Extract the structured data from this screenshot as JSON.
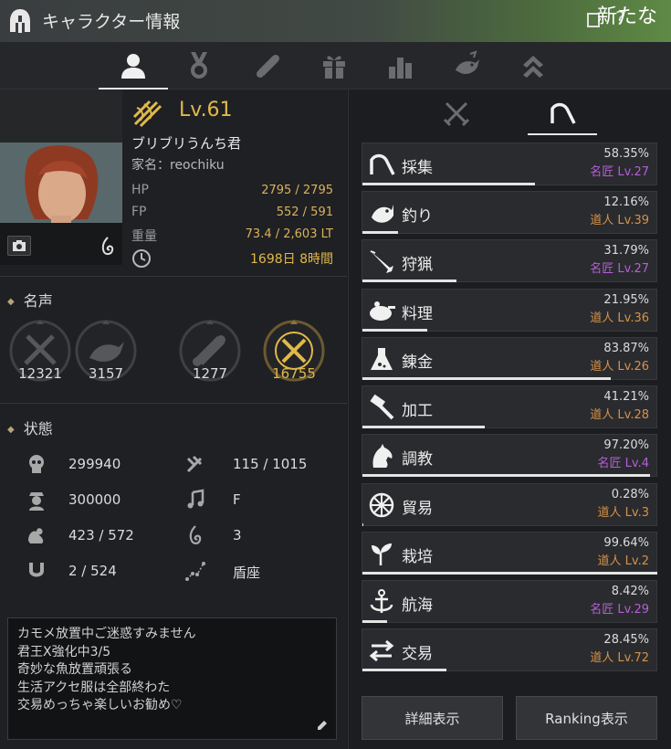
{
  "window": {
    "title": "キャラクター情報",
    "overflow_text": "新たな"
  },
  "tabs": [
    "profile-icon",
    "medal-icon",
    "scroll-icon",
    "gift-icon",
    "bar-chart-icon",
    "fishing-icon",
    "chevron-up-icon"
  ],
  "character": {
    "level": "Lv.61",
    "name": "ブリブリうんち君",
    "family": "家名：reochiku",
    "hp_label": "HP",
    "hp": "2795 / 2795",
    "fp_label": "FP",
    "fp": "552 / 591",
    "weight_label": "重量",
    "weight": "73.4 / 2,603 LT",
    "playtime": "1698日 8時間"
  },
  "fame": {
    "title": "名声",
    "items": [
      {
        "icon": "crossed-swords-icon",
        "value": "12321"
      },
      {
        "icon": "fishing-icon",
        "value": "3157"
      },
      {
        "icon": "scroll-icon",
        "value": "1277"
      },
      {
        "icon": "crossed-tools-icon",
        "value": "16755"
      }
    ]
  },
  "status": {
    "title": "状態",
    "stats": [
      {
        "icon": "skull-icon",
        "value": "299940"
      },
      {
        "icon": "axe-icon",
        "value": "115 / 1015"
      },
      {
        "icon": "soldier-icon",
        "value": "300000"
      },
      {
        "icon": "music-note-icon",
        "value": "F"
      },
      {
        "icon": "muscle-icon",
        "value": "423 / 572"
      },
      {
        "icon": "flame-icon",
        "value": "3"
      },
      {
        "icon": "horseshoe-icon",
        "value": "2 / 524"
      },
      {
        "icon": "constellation-icon",
        "value": "盾座"
      }
    ]
  },
  "memo": {
    "lines": [
      "カモメ放置中ご迷惑すみません",
      "君王X強化中3/5",
      "奇妙な魚放置頑張る",
      "生活アクセ服は全部終わた",
      "交易めっちゃ楽しいお勧め♡"
    ]
  },
  "life_skills": [
    {
      "name": "採集",
      "percent": "58.35%",
      "rank": "名匠 Lv.27",
      "tier": "guru",
      "progress": 58.35
    },
    {
      "name": "釣り",
      "percent": "12.16%",
      "rank": "道人 Lv.39",
      "tier": "master",
      "progress": 12.16
    },
    {
      "name": "狩猟",
      "percent": "31.79%",
      "rank": "名匠 Lv.27",
      "tier": "guru",
      "progress": 31.79
    },
    {
      "name": "料理",
      "percent": "21.95%",
      "rank": "道人 Lv.36",
      "tier": "master",
      "progress": 21.95
    },
    {
      "name": "錬金",
      "percent": "83.87%",
      "rank": "道人 Lv.26",
      "tier": "master",
      "progress": 83.87
    },
    {
      "name": "加工",
      "percent": "41.21%",
      "rank": "道人 Lv.28",
      "tier": "master",
      "progress": 41.21
    },
    {
      "name": "調教",
      "percent": "97.20%",
      "rank": "名匠 Lv.4",
      "tier": "guru",
      "progress": 97.2
    },
    {
      "name": "貿易",
      "percent": "0.28%",
      "rank": "道人 Lv.3",
      "tier": "master",
      "progress": 0.28
    },
    {
      "name": "栽培",
      "percent": "99.64%",
      "rank": "道人 Lv.2",
      "tier": "master",
      "progress": 99.64
    },
    {
      "name": "航海",
      "percent": "8.42%",
      "rank": "名匠 Lv.29",
      "tier": "guru",
      "progress": 8.42
    },
    {
      "name": "交易",
      "percent": "28.45%",
      "rank": "道人 Lv.72",
      "tier": "master",
      "progress": 28.45
    }
  ],
  "colors": {
    "guru": "#b65ed8",
    "master": "#d5924a",
    "gold": "#e0b94a"
  },
  "buttons": {
    "detail": "詳細表示",
    "ranking": "Ranking表示"
  }
}
